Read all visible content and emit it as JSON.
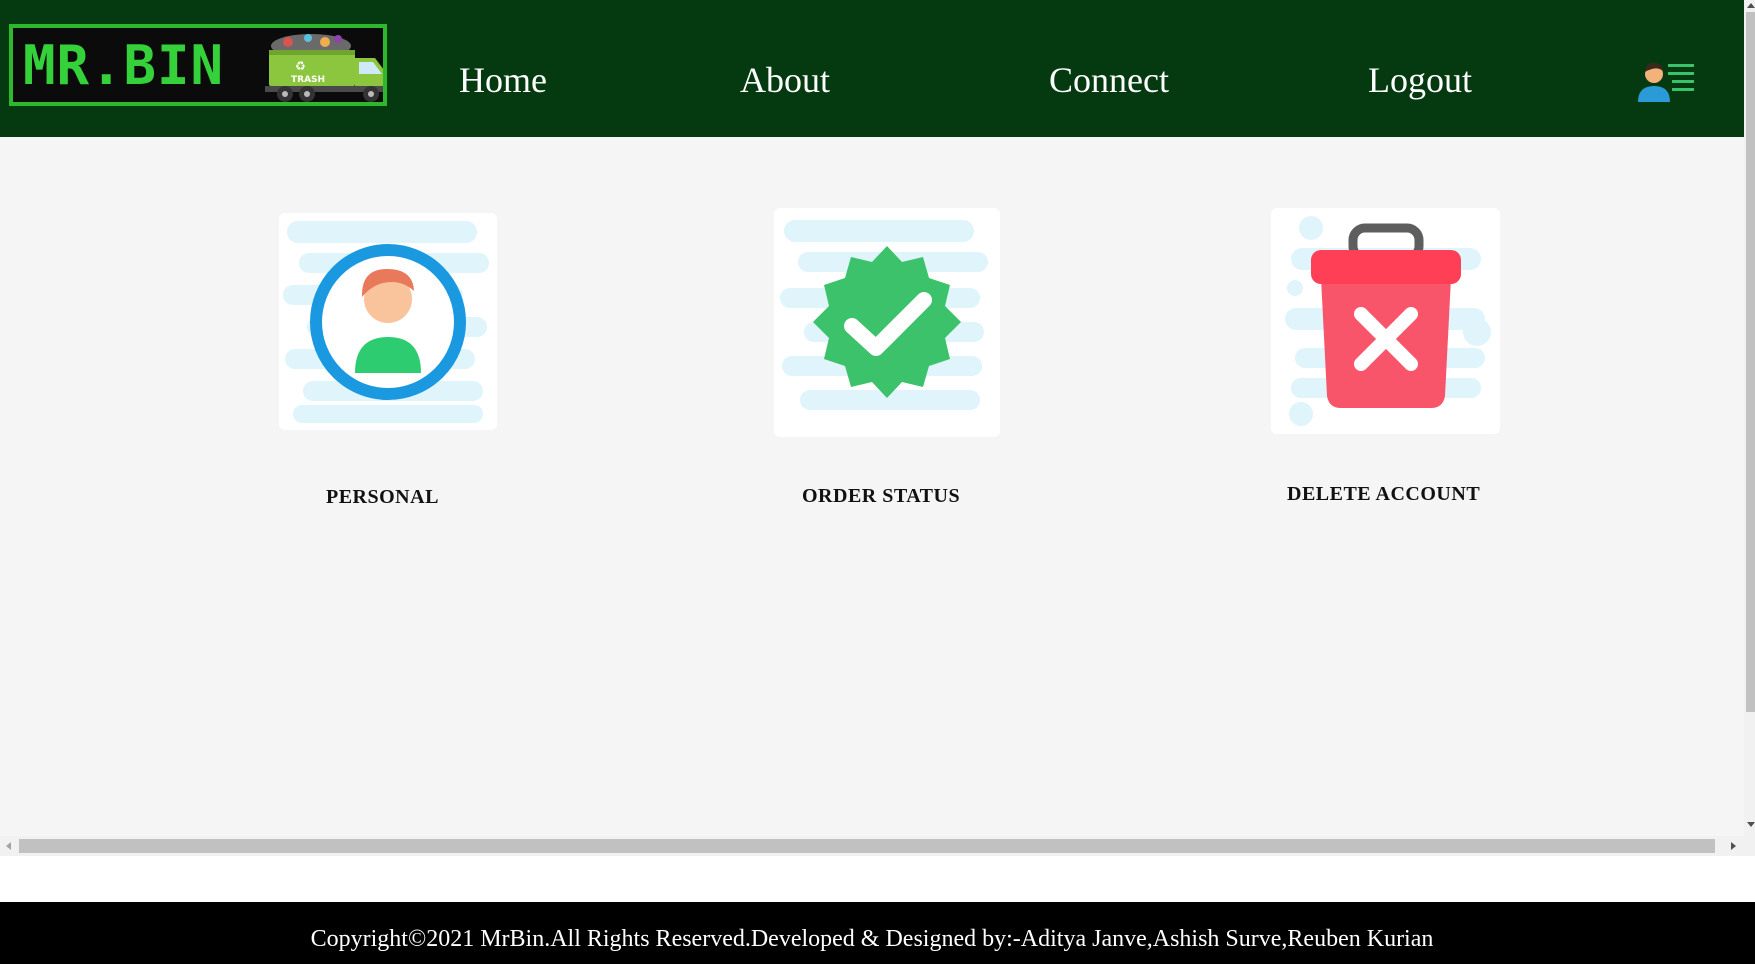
{
  "header": {
    "logo_text": "MR.BIN",
    "truck_label": "TRASH",
    "nav": {
      "home": "Home",
      "about": "About",
      "connect": "Connect",
      "logout": "Logout"
    },
    "user_menu_icon": "user-menu-icon"
  },
  "cards": [
    {
      "label": "PERSONAL",
      "icon": "user-profile-icon"
    },
    {
      "label": "ORDER STATUS",
      "icon": "verified-check-icon"
    },
    {
      "label": "DELETE ACCOUNT",
      "icon": "delete-bin-icon"
    }
  ],
  "footer": {
    "text": "Copyright©2021 MrBin.All Rights Reserved.Developed & Designed by:-Aditya Janve,Ashish Surve,Reuben Kurian"
  },
  "colors": {
    "header_bg": "#053a11",
    "logo_green": "#35d13a",
    "footer_bg": "#000000",
    "check_green": "#3cc26a",
    "delete_red": "#f8556a",
    "profile_ring": "#1a98e0"
  }
}
